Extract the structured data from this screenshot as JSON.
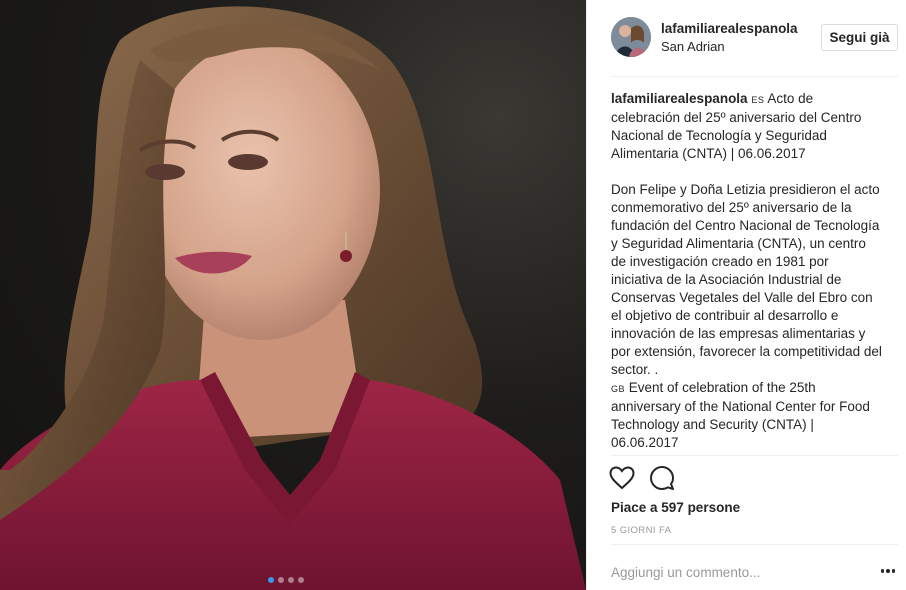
{
  "post": {
    "username": "lafamiliarealespanola",
    "location": "San Adrian",
    "follow_label": "Segui già",
    "caption": {
      "username": "lafamiliarealespanola",
      "flag_es": "ES",
      "line1": "Acto de celebración del 25º aniversario del Centro Nacional de Tecnología y Seguridad Alimentaria (CNTA) | 06.06.2017",
      "line2": "Don Felipe y Doña Letizia presidieron el acto conmemorativo del 25º aniversario de la fundación del Centro Nacional de Tecnología y Seguridad Alimentaria (CNTA), un centro de investigación creado en 1981 por iniciativa de la Asociación Industrial de Conservas Vegetales del Valle del Ebro con el objetivo de contribuir al desarrollo e innovación de las empresas alimentarias y por extensión, favorecer la competitividad del sector. .",
      "flag_gb": "GB",
      "line3": "Event of celebration of the 25th anniversary of the National Center for Food Technology and Security (CNTA) | 06.06.2017"
    },
    "likes_text": "Piace a 597 persone",
    "time_text": "5 GIORNI FA",
    "comment_placeholder": "Aggiungi un commento...",
    "carousel": {
      "total": 4,
      "active": 1
    }
  },
  "icons": {
    "like": "heart-icon",
    "comment": "comment-icon",
    "more": "more-options-icon"
  },
  "colors": {
    "accent": "#3897f0",
    "text": "#262626",
    "muted": "#999999",
    "border": "#efefef",
    "blouse": "#8e1d3d"
  }
}
